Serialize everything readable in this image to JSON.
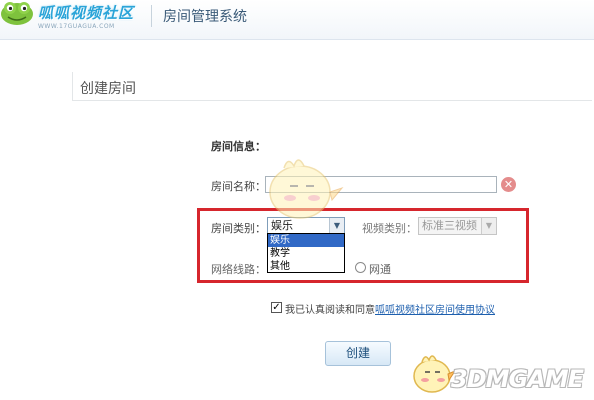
{
  "header": {
    "logo_text": "呱呱视频社区",
    "logo_url": "WWW.17GUAGUA.COM",
    "system_title": "房间管理系统"
  },
  "page": {
    "title": "创建房间"
  },
  "form": {
    "section_label": "房间信息：",
    "room_name_label": "房间名称：",
    "room_name_value": "",
    "room_type_label": "房间类别：",
    "room_type_selected": "娱乐",
    "room_type_options": [
      "娱乐",
      "教学",
      "其他"
    ],
    "video_type_label": "视频类别：",
    "video_type_selected": "标准三视频",
    "network_label": "网络线路：",
    "network_option_label": "网通",
    "agree_checked": true,
    "agree_text": "我已认真阅读和同意",
    "agree_link": "呱呱视频社区房间使用协议",
    "create_button": "创建"
  },
  "watermark": {
    "text": "3DMGAME"
  },
  "colors": {
    "highlight_border": "#d6262d",
    "link": "#1d5fae",
    "dropdown_selected": "#3169c6"
  }
}
